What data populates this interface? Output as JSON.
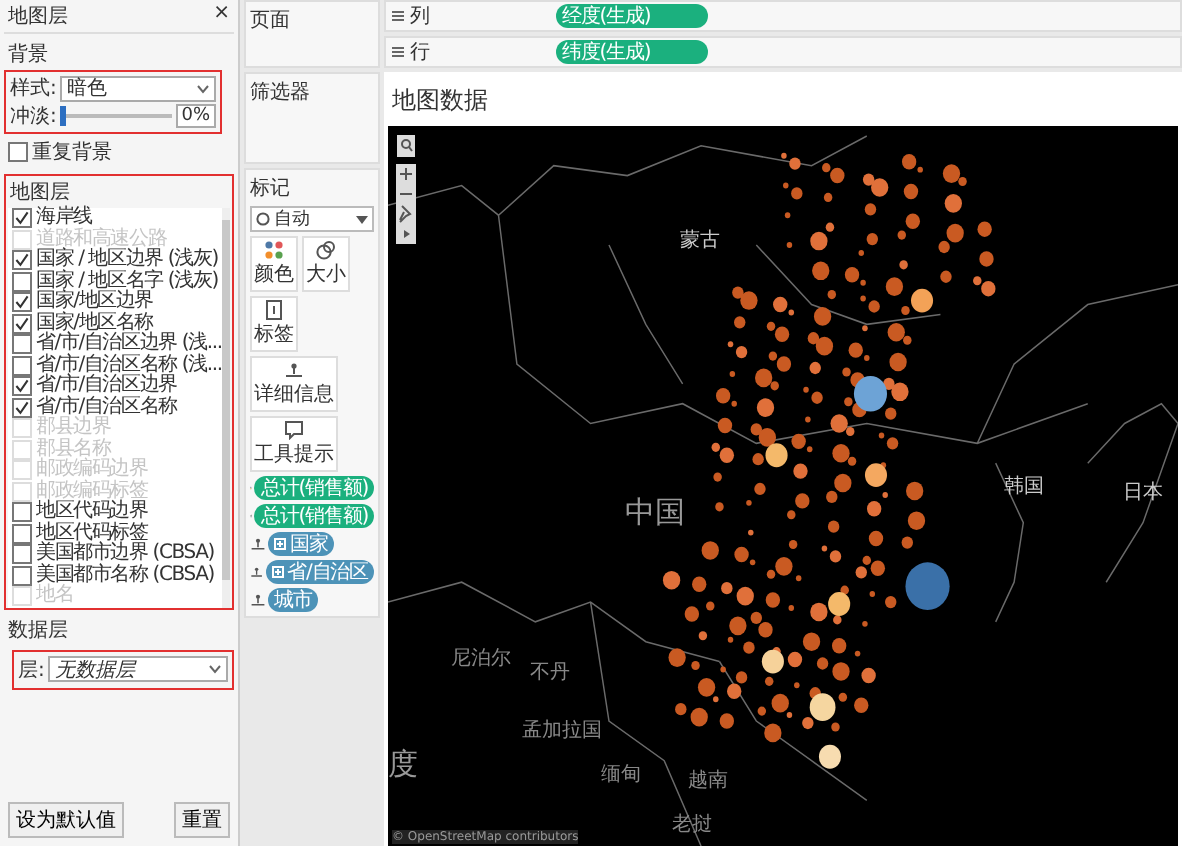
{
  "left_panel": {
    "title": "地图层",
    "close": "×",
    "background": {
      "heading": "背景",
      "style_label": "样式:",
      "style_value": "暗色",
      "fade": {
        "label": "冲淡:",
        "level": 0,
        "reading": "0%"
      },
      "repeat": {
        "label": "重复背景",
        "checked": false
      }
    },
    "layers": {
      "heading": "地图层",
      "items": [
        {
          "label": "海岸线",
          "checked": true,
          "disabled": false
        },
        {
          "label": "道路和高速公路",
          "checked": false,
          "disabled": true
        },
        {
          "label": "国家 / 地区边界 (浅灰)",
          "checked": true,
          "disabled": false
        },
        {
          "label": "国家 / 地区名字 (浅灰)",
          "checked": false,
          "disabled": false
        },
        {
          "label": "国家/地区边界",
          "checked": true,
          "disabled": false
        },
        {
          "label": "国家/地区名称",
          "checked": true,
          "disabled": false
        },
        {
          "label": "省/市/自治区边界 (浅...",
          "checked": false,
          "disabled": false
        },
        {
          "label": "省/市/自治区名称 (浅...",
          "checked": false,
          "disabled": false
        },
        {
          "label": "省/市/自治区边界",
          "checked": true,
          "disabled": false
        },
        {
          "label": "省/市/自治区名称",
          "checked": true,
          "disabled": false
        },
        {
          "label": "郡县边界",
          "checked": false,
          "disabled": true
        },
        {
          "label": "郡县名称",
          "checked": false,
          "disabled": true
        },
        {
          "label": "邮政编码边界",
          "checked": false,
          "disabled": true
        },
        {
          "label": "邮政编码标签",
          "checked": false,
          "disabled": true
        },
        {
          "label": "地区代码边界",
          "checked": false,
          "disabled": false
        },
        {
          "label": "地区代码标签",
          "checked": false,
          "disabled": false
        },
        {
          "label": "美国都市边界 (CBSA)",
          "checked": false,
          "disabled": false
        },
        {
          "label": "美国都市名称 (CBSA)",
          "checked": false,
          "disabled": false
        },
        {
          "label": "地名",
          "checked": false,
          "disabled": true
        }
      ]
    },
    "data_layer": {
      "heading": "数据层",
      "layer_label": "层:",
      "layer_value": "无数据层"
    },
    "buttons": [
      "设为默认值",
      "重置"
    ]
  },
  "shelves": {
    "pages": "页面",
    "filters": "筛选器",
    "columns": {
      "label": "列",
      "pill": "经度(生成)"
    },
    "rows": {
      "label": "行",
      "pill": "纬度(生成)"
    }
  },
  "marks": {
    "heading": "标记",
    "mark_type": "自动",
    "cards": [
      {
        "kind": "color",
        "label": "颜色"
      },
      {
        "kind": "size",
        "label": "大小"
      },
      {
        "kind": "label",
        "label": "标签"
      },
      {
        "kind": "detail",
        "label": "详细信息"
      },
      {
        "kind": "tooltip",
        "label": "工具提示"
      }
    ],
    "fields": [
      {
        "kind": "color",
        "label": "总计(销售额)",
        "color": "#1bb07e",
        "plus": false
      },
      {
        "kind": "size",
        "label": "总计(销售额)",
        "color": "#1bb07e",
        "plus": false
      },
      {
        "kind": "detail",
        "label": "国家",
        "color": "#4d93b8",
        "plus": true
      },
      {
        "kind": "detail",
        "label": "省/自治区",
        "color": "#4d93b8",
        "plus": true
      },
      {
        "kind": "detail",
        "label": "城市",
        "color": "#4d93b8",
        "plus": false
      }
    ]
  },
  "view": {
    "title": "地图数据",
    "map_labels": [
      {
        "text": "蒙古",
        "kind": "country"
      },
      {
        "text": "中国",
        "kind": "major"
      },
      {
        "text": "韩国",
        "kind": "country"
      },
      {
        "text": "日本",
        "kind": "country"
      },
      {
        "text": "度",
        "kind": "major"
      },
      {
        "text": "尼泊尔",
        "kind": "minor"
      },
      {
        "text": "不丹",
        "kind": "minor"
      },
      {
        "text": "孟加拉国",
        "kind": "minor"
      },
      {
        "text": "缅甸",
        "kind": "minor"
      },
      {
        "text": "越南",
        "kind": "minor"
      },
      {
        "text": "老挝",
        "kind": "minor"
      }
    ],
    "attribution": "© OpenStreetMap contributors"
  }
}
